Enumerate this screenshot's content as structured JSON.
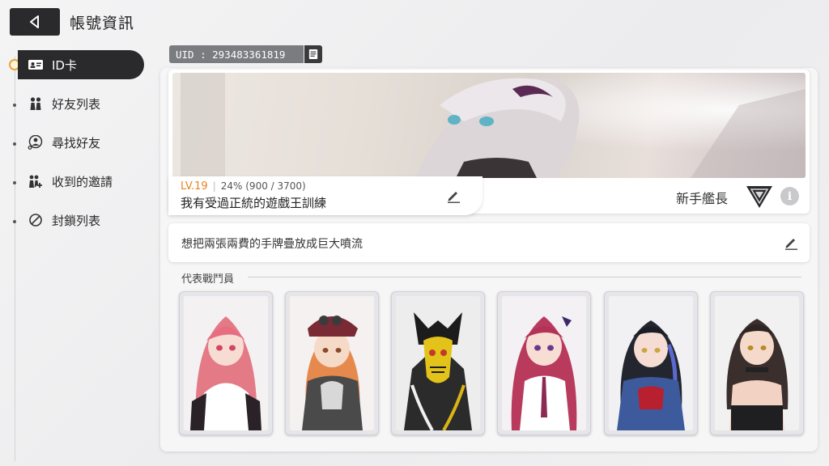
{
  "header": {
    "title": "帳號資訊",
    "back_icon": "back-arrow-icon"
  },
  "sidebar": {
    "items": [
      {
        "label": "ID卡",
        "icon": "id-card-icon",
        "active": true
      },
      {
        "label": "好友列表",
        "icon": "friends-icon",
        "active": false
      },
      {
        "label": "尋找好友",
        "icon": "search-user-icon",
        "active": false
      },
      {
        "label": "收到的邀請",
        "icon": "invite-icon",
        "active": false
      },
      {
        "label": "封鎖列表",
        "icon": "block-icon",
        "active": false
      }
    ]
  },
  "profile": {
    "uid": "UID : 293483361819",
    "level": "LV.19",
    "exp_text": "24% (900 / 3700)",
    "exp_progress": 0.24,
    "nickname": "我有受過正統的遊戲王訓練",
    "rank_title": "新手艦長",
    "motto": "想把兩張兩費的手牌疊放成巨大噴流"
  },
  "representatives": {
    "label": "代表戰鬥員",
    "count_shown": 6
  },
  "colors": {
    "accent": "#e8841f",
    "dark": "#2a2a2c",
    "panel": "#f6f6f7"
  }
}
